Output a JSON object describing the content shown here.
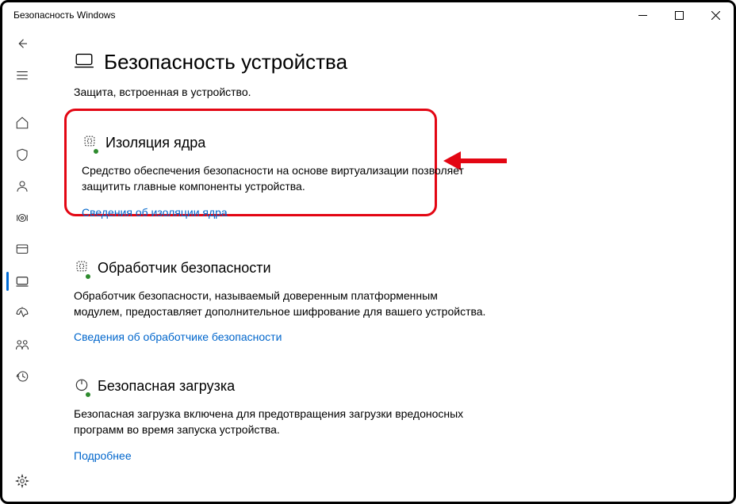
{
  "window": {
    "title": "Безопасность Windows"
  },
  "page": {
    "title": "Безопасность устройства",
    "subtitle": "Защита, встроенная в устройство."
  },
  "sections": {
    "core_isolation": {
      "title": "Изоляция ядра",
      "desc": "Средство обеспечения безопасности на основе виртуализации позволяет защитить главные компоненты устройства.",
      "link": "Сведения об изоляции ядра"
    },
    "security_processor": {
      "title": "Обработчик безопасности",
      "desc": "Обработчик безопасности, называемый доверенным платформенным модулем, предоставляет дополнительное шифрование для вашего устройства.",
      "link": "Сведения об обработчике безопасности"
    },
    "secure_boot": {
      "title": "Безопасная загрузка",
      "desc": "Безопасная загрузка включена для предотвращения загрузки вредоносных программ во время запуска устройства.",
      "link": "Подробнее"
    }
  }
}
